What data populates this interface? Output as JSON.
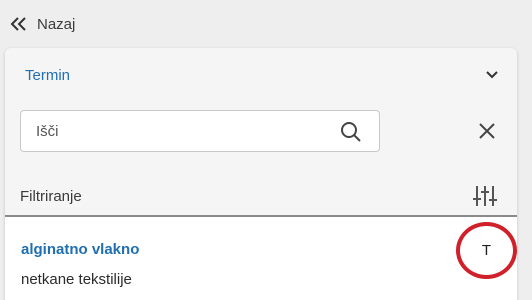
{
  "nav": {
    "back_label": "Nazaj"
  },
  "panel": {
    "title": "Termin",
    "search": {
      "placeholder": "Išči",
      "value": ""
    },
    "filter_label": "Filtriranje"
  },
  "results": [
    {
      "term": "alginatno vlakno",
      "description": "netkane tekstilije",
      "badge": "T"
    }
  ],
  "colors": {
    "accent": "#1f6fb2",
    "highlight_circle": "#d0202a"
  }
}
